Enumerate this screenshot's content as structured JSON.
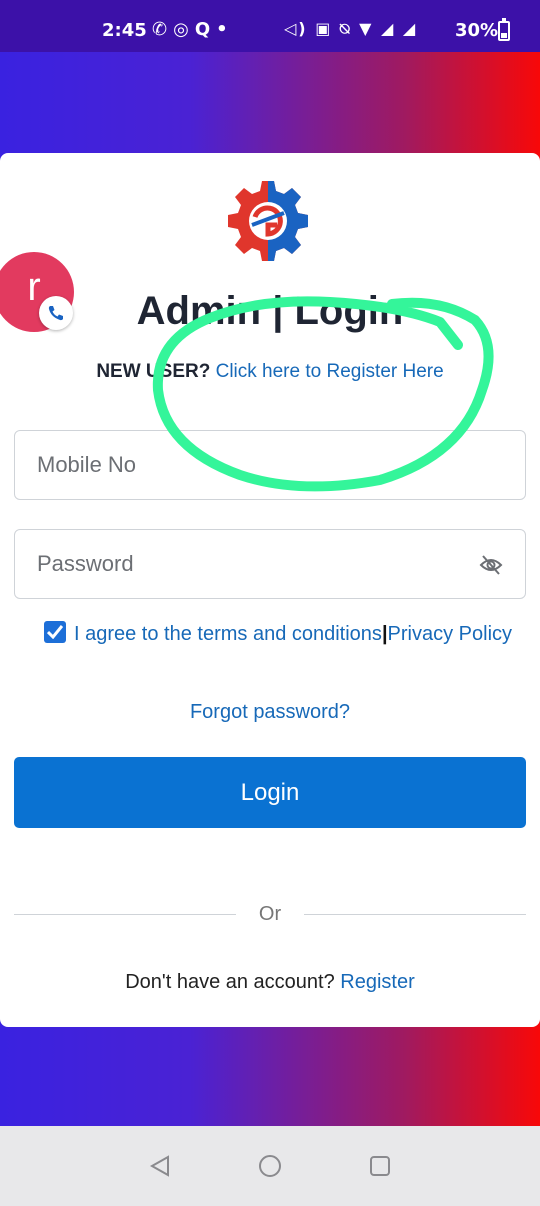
{
  "status_bar": {
    "time": "2:45",
    "icons_left": [
      "phone-call-icon",
      "instagram-icon",
      "q-icon",
      "dot-icon"
    ],
    "icons_right": [
      "volume-icon",
      "vowifi-icon",
      "mute-icon",
      "wifi-icon",
      "signal-icon",
      "signal-icon"
    ],
    "battery": "30%"
  },
  "header": {
    "title": "Admin | Login"
  },
  "new_user": {
    "label": "NEW USER?",
    "link": "Click here to Register Here"
  },
  "form": {
    "mobile_placeholder": "Mobile No",
    "password_placeholder": "Password",
    "agree_text": "I agree to the terms and conditions",
    "divider": "|",
    "privacy_text": "Privacy Policy",
    "agreed": true,
    "forgot": "Forgot password?",
    "login_label": "Login"
  },
  "or_label": "Or",
  "register": {
    "prompt": "Don't have an account?",
    "link": "Register"
  },
  "chat_bubble": {
    "letter": "r"
  },
  "colors": {
    "primary": "#0a72d2",
    "link": "#1769b8",
    "annotation": "#34f59a",
    "gradient_start": "#3a22e0",
    "gradient_end": "#f80808"
  }
}
